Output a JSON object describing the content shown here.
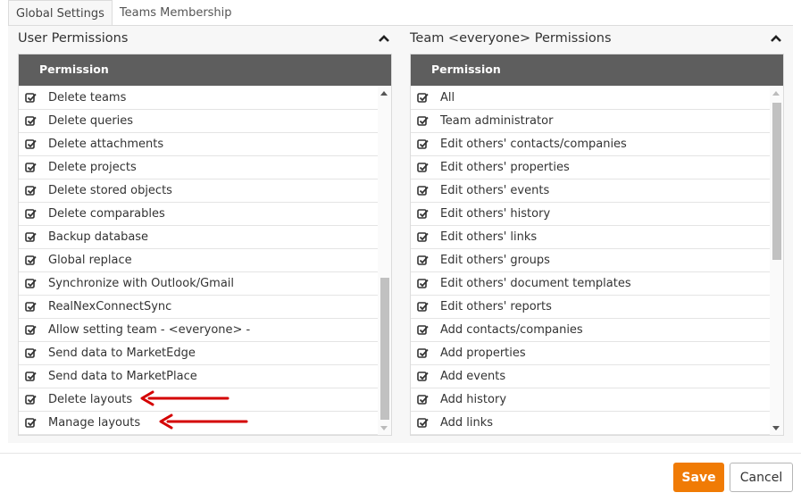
{
  "tabs": [
    {
      "label": "Global Settings",
      "active": true
    },
    {
      "label": "Teams Membership",
      "active": false
    }
  ],
  "user_permissions": {
    "title": "User Permissions",
    "column_header": "Permission",
    "items": [
      "Delete teams",
      "Delete queries",
      "Delete attachments",
      "Delete projects",
      "Delete stored objects",
      "Delete comparables",
      "Backup database",
      "Global replace",
      "Synchronize with Outlook/Gmail",
      "RealNexConnectSync",
      "Allow setting team - <everyone> -",
      "Send data to MarketEdge",
      "Send data to MarketPlace",
      "Delete layouts",
      "Manage layouts"
    ],
    "scroll_position": 1.0
  },
  "team_permissions": {
    "title": "Team <everyone> Permissions",
    "column_header": "Permission",
    "items": [
      "All",
      "Team administrator",
      "Edit others' contacts/companies",
      "Edit others' properties",
      "Edit others' events",
      "Edit others' history",
      "Edit others' links",
      "Edit others' groups",
      "Edit others' document templates",
      "Edit others' reports",
      "Add contacts/companies",
      "Add properties",
      "Add events",
      "Add history",
      "Add links"
    ],
    "scroll_position": 0.0
  },
  "footer": {
    "save_label": "Save",
    "cancel_label": "Cancel"
  },
  "colors": {
    "accent": "#f07b05",
    "header_bg": "#5e5e5e",
    "annotation_arrow": "#d40000"
  },
  "icons": {
    "checkbox": "checkbox-checked-icon",
    "collapse": "chevron-up-icon"
  }
}
